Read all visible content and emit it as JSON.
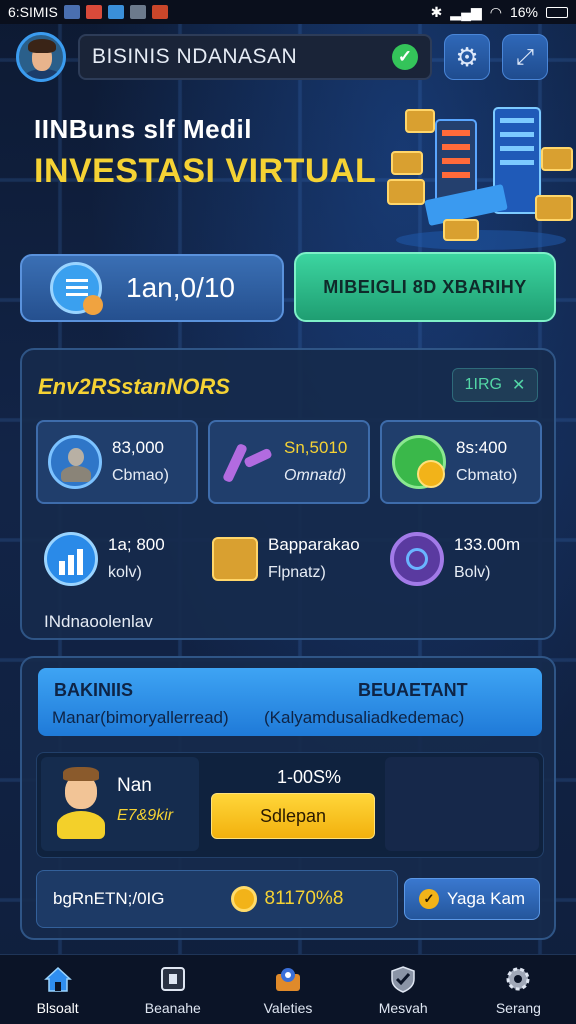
{
  "status_bar": {
    "carrier": "6:SIMIS",
    "battery": "16%"
  },
  "header": {
    "title": "BISINIS NDANASAN"
  },
  "hero": {
    "subtitle": "IINBuns slf Medil",
    "title": "INVESTASI VIRTUAL"
  },
  "actions": {
    "balance_value": "1an,0/10",
    "green_button_label": "MIBEIGLI 8D XBARIHY"
  },
  "stats_panel": {
    "title": "Env2RSstanNORS",
    "tag": "1IRG",
    "cards": [
      {
        "value": "83,000",
        "label": "Cbmao)",
        "icon": "user-silhouette-icon"
      },
      {
        "value": "Sn,5010",
        "label": "Omnatd)",
        "icon": "boomerang-icon"
      },
      {
        "value": "8s:400",
        "label": "Cbmato)",
        "icon": "coin-globe-icon"
      }
    ],
    "flat_items": [
      {
        "value": "1a; 800",
        "label": "kolv)",
        "icon": "chart-icon"
      },
      {
        "value": "Bapparakao",
        "label": "Flpnatz)",
        "icon": "gold-block-icon"
      },
      {
        "value": "133.00m",
        "label": "Bolv)",
        "icon": "target-icon"
      }
    ],
    "footer": "INdnaoolenlav"
  },
  "business_panel": {
    "header_left_title": "BAKINIIS",
    "header_right_title": "BEUAETANT",
    "header_left_sub": "Manar(bimoryallerread)",
    "header_right_sub": "(Kalyamdusaliadkedemac)",
    "person_name": "Nan",
    "person_sub": "E7&9kir",
    "percent": "1-00S%",
    "action_button": "Sdlepan",
    "footer_label": "bgRnETN;/0IG",
    "footer_amount": "81170%8",
    "footer_button": "Yaga Kam"
  },
  "bottom_nav": [
    {
      "label": "Blsoalt",
      "icon": "home-icon",
      "active": true
    },
    {
      "label": "Beanahe",
      "icon": "box-icon",
      "active": false
    },
    {
      "label": "Valeties",
      "icon": "map-pin-icon",
      "active": false
    },
    {
      "label": "Mesvah",
      "icon": "shield-check-icon",
      "active": false
    },
    {
      "label": "Serang",
      "icon": "gear-icon",
      "active": false
    }
  ],
  "colors": {
    "accent": "#f5d234",
    "primary": "#2f68b8",
    "success": "#34c45a",
    "teal": "#3cd5a0",
    "background": "#122447"
  }
}
